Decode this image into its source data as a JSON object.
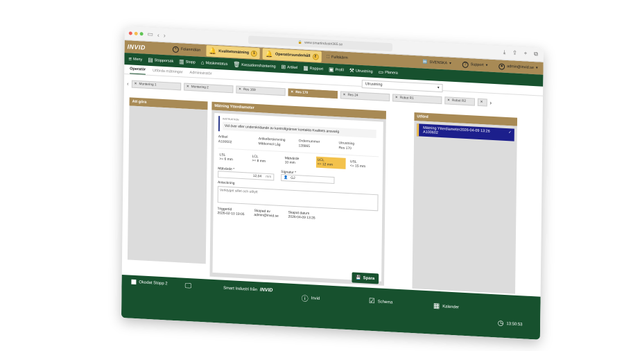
{
  "browser": {
    "url": "www.smartindustri365.se"
  },
  "topbar": {
    "logo": "INVID",
    "items": [
      {
        "label": "Felanmälan",
        "icon": "plus-circle-icon"
      },
      {
        "label": "Kvalitetsmätning",
        "icon": "bell-icon",
        "badge": "1"
      },
      {
        "label": "Operatörsunderhåll",
        "icon": "bell-icon",
        "badge": "2"
      },
      {
        "label": "Fullskärm",
        "icon": "fullscreen-icon"
      },
      {
        "label": "SVENSKA",
        "icon": "language-icon"
      },
      {
        "label": "Support",
        "icon": "help-icon"
      },
      {
        "label": "admin@invid.se",
        "icon": "user-icon"
      }
    ]
  },
  "navbar": {
    "items": [
      "Meny",
      "Stopporsak",
      "Stopp",
      "Maskinstatus",
      "Kassationshantering",
      "Artikel",
      "Rapport",
      "Profil",
      "Utrustning",
      "Planera"
    ]
  },
  "tabs": [
    "Operatör",
    "Utförda mätningar",
    "Administratör"
  ],
  "dropdown": {
    "value": "Utrustning"
  },
  "stations": [
    "Montering 1",
    "Montering 2",
    "Res 169",
    "Res 170",
    "Res 24",
    "Robot R1",
    "Robot R2",
    ""
  ],
  "left": {
    "title": "Att göra"
  },
  "form": {
    "title": "Mätning Ytterdiameter",
    "instruction_label": "INSTRUKTION",
    "instruction": "Vid över eller underskridande av kontrollgränser kontakta Kvalitets ansvarig",
    "info": [
      {
        "k": "Artikel",
        "v": "A100602"
      },
      {
        "k": "Artikelbeskrivning",
        "v": "Mittkonsol Låg"
      },
      {
        "k": "Ordernummer",
        "v": "128865"
      },
      {
        "k": "Utrustning",
        "v": "Res 170"
      }
    ],
    "limits": [
      {
        "k": "LSL",
        "v": ">= 6 mm"
      },
      {
        "k": "LCL",
        "v": ">= 8 mm"
      },
      {
        "k": "Mätvärde",
        "v": "10 mm"
      },
      {
        "k": "UCL",
        "v": "<= 12 mm"
      },
      {
        "k": "USL",
        "v": "<= 15 mm"
      }
    ],
    "measure_label": "Mätvärde *",
    "measure_value": "12,04",
    "measure_unit": "mm",
    "signature_label": "Signatur *",
    "signature_value": "GJ",
    "note_label": "Anteckning",
    "note_value": "Verktyget sillet och utbytt",
    "meta": [
      {
        "k": "Triggertid",
        "v": "2026-02-10 19:05"
      },
      {
        "k": "Skapad av",
        "v": "admin@invid.se"
      },
      {
        "k": "Skapat datum",
        "v": "2026-04-09 13:26"
      }
    ],
    "save": "Spara"
  },
  "right": {
    "title": "Utförd",
    "item_title": "Mätning Ytterdiameter2026-04-09 13:26",
    "item_sub": "A100602"
  },
  "footer": {
    "stop": "Okodat Stopp 2",
    "brand": "Smart Industri från",
    "brand_logo": "INVID",
    "links": [
      "Invid",
      "Schema",
      "Kalender"
    ],
    "clock": "13:50:53"
  }
}
